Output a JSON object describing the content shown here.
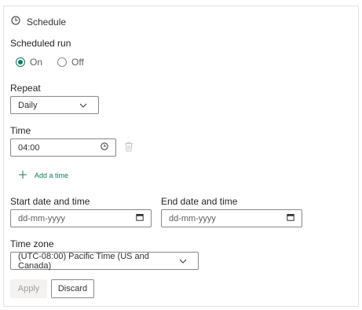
{
  "header": {
    "title": "Schedule",
    "icon": "clock-icon"
  },
  "scheduled_run": {
    "label": "Scheduled run",
    "options": [
      {
        "label": "On",
        "checked": true
      },
      {
        "label": "Off",
        "checked": false
      }
    ],
    "accent": "#117865"
  },
  "repeat": {
    "label": "Repeat",
    "value": "Daily"
  },
  "time": {
    "label": "Time",
    "value": "04:00"
  },
  "add_time": {
    "label": "Add a time"
  },
  "start": {
    "label": "Start date and time",
    "placeholder": "dd-mm-yyyy"
  },
  "end": {
    "label": "End date and time",
    "placeholder": "dd-mm-yyyy"
  },
  "timezone": {
    "label": "Time zone",
    "value": "(UTC-08:00) Pacific Time (US and Canada)"
  },
  "buttons": {
    "apply": "Apply",
    "discard": "Discard"
  }
}
